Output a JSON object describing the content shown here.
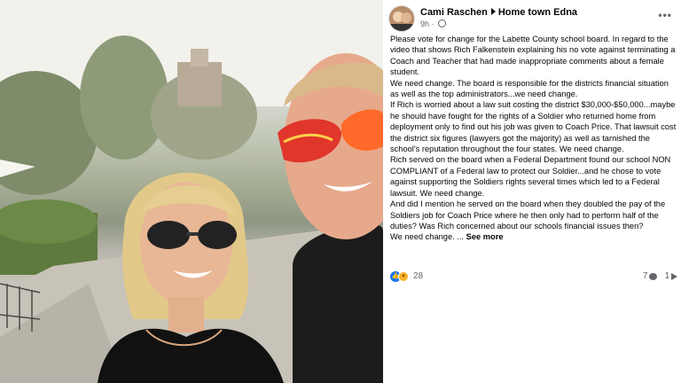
{
  "post": {
    "author": "Cami Raschen",
    "group": "Home town Edna",
    "time": "9h",
    "options_icon": "more-dots-icon",
    "body": "Please vote for change for the Labette County school board. In regard to the video that shows Rich Falkenstein explaining his no vote against terminating a Coach and Teacher that had made inappropriate comments about a female student.\nWe need change. The board is responsible for the districts financial situation as well as the top administrators...we need change.\nIf Rich is worried about a law suit costing the district $30,000-$50,000...maybe he should have fought for the rights of a Soldier who returned home from deployment only to find out his job was given to Coach Price. That lawsuit cost the district six figures (lawyers got the majority) as well as tarnished the school's reputation throughout the four states. We need change.\nRich served on the board when a Federal Department found our school NON COMPLIANT of a Federal law to protect our Soldier...and he chose to vote against supporting the Soldiers rights several times which led to a Federal lawsuit. We need change.\nAnd did I mention he served on the board when they doubled the pay of the Soldiers job for Coach Price where he then only had to perform half of the duties? Was Rich concerned about our schools financial issues then?\nWe need change. ...",
    "see_more": "See more",
    "reactions_count": "28",
    "comments_count": "7",
    "shares_count": "1"
  }
}
